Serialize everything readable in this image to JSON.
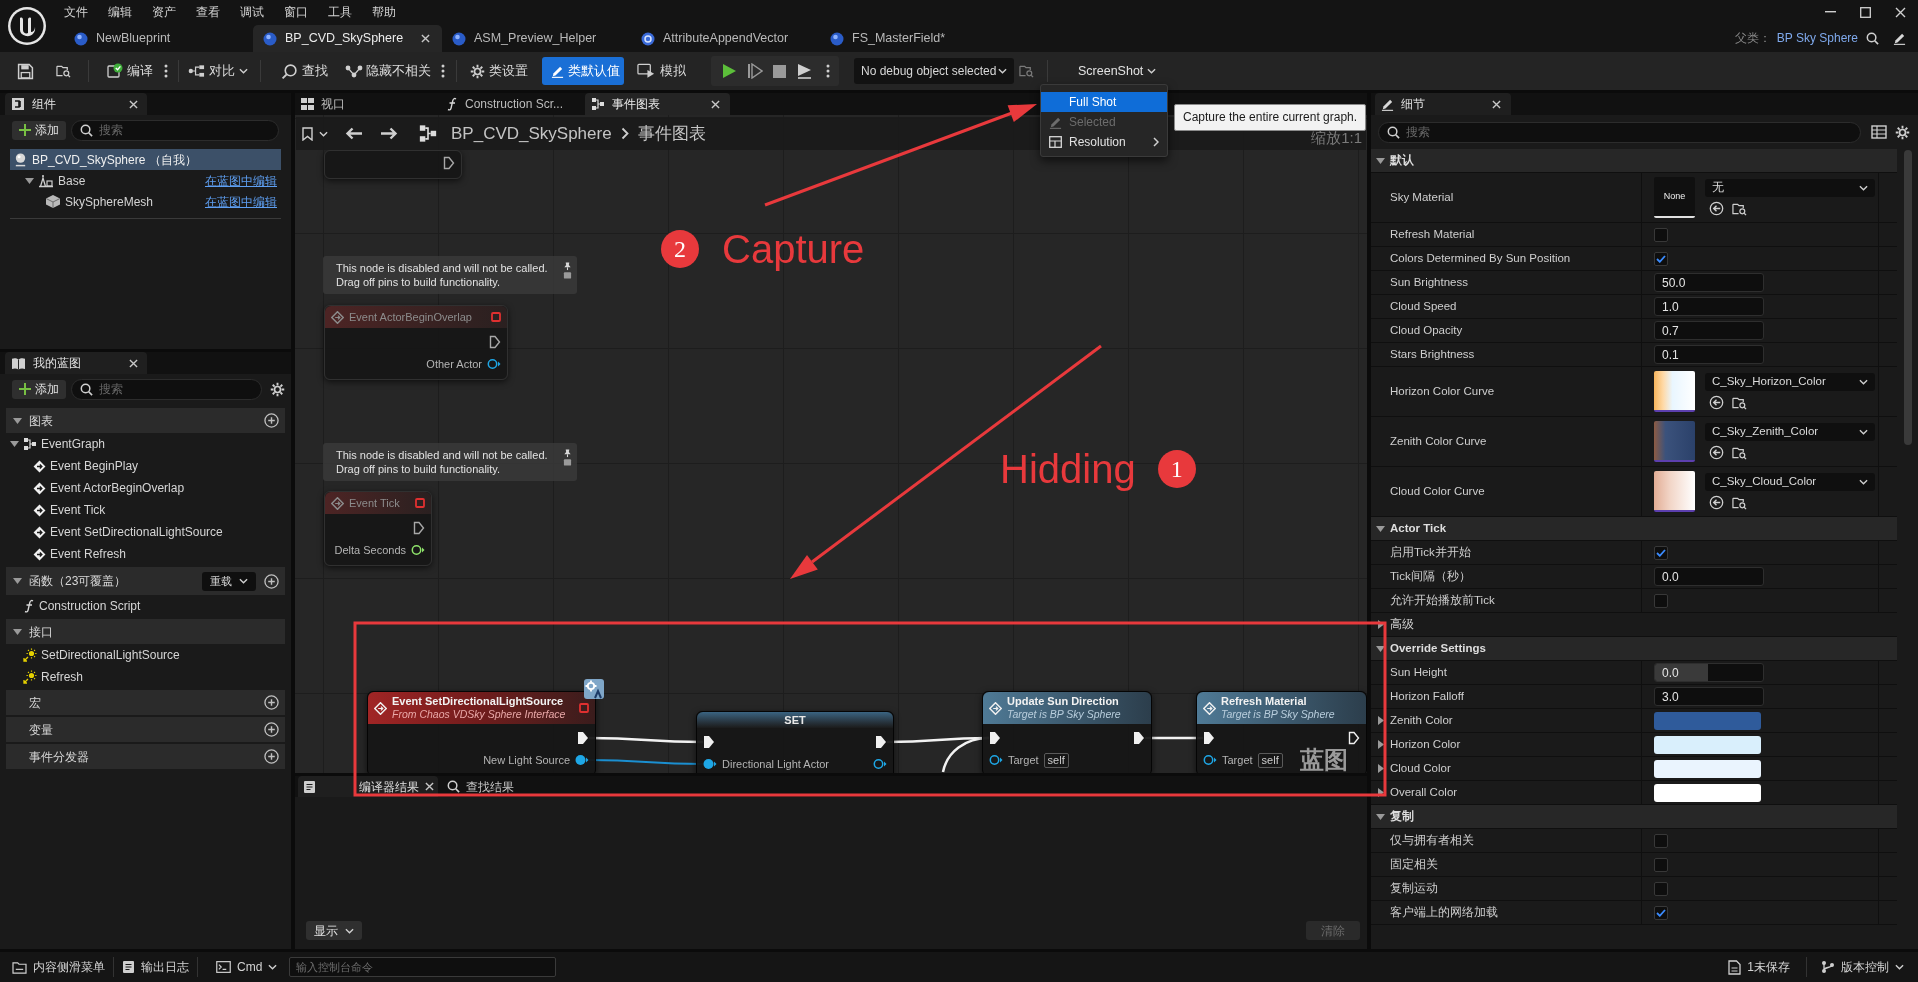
{
  "title_bar": {
    "menu": [
      "文件",
      "编辑",
      "资产",
      "查看",
      "调试",
      "窗口",
      "工具",
      "帮助"
    ]
  },
  "document_tabs": [
    {
      "label": "NewBlueprint",
      "kind": "blueprint",
      "selected": false
    },
    {
      "label": "BP_CVD_SkySphere",
      "kind": "blueprint",
      "selected": true
    },
    {
      "label": "ASM_Preview_Helper",
      "kind": "blueprint",
      "selected": false
    },
    {
      "label": "AttributeAppendVector",
      "kind": "material_function",
      "selected": false
    },
    {
      "label": "FS_MasterField*",
      "kind": "blueprint",
      "selected": false
    }
  ],
  "parent_class": {
    "label": "父类：",
    "value": "BP Sky Sphere"
  },
  "toolbar": {
    "compile": "编译",
    "diff": "对比",
    "find": "查找",
    "hide_unrelated": "隐藏不相关",
    "class_settings": "类设置",
    "class_defaults": {
      "label": "类默认值",
      "selected": true
    },
    "simulate": "模拟",
    "debug_object": "No debug object selected",
    "screenshot": "ScreenShot"
  },
  "screenshot_menu": {
    "items": [
      {
        "label": "Full Shot",
        "kind": "action",
        "selected": true,
        "disabled": false
      },
      {
        "label": "Selected",
        "kind": "selection",
        "selected": false,
        "disabled": true
      },
      {
        "label": "Resolution",
        "kind": "submenu",
        "selected": false,
        "disabled": false
      }
    ]
  },
  "tooltip": {
    "text": "Capture the entire current graph."
  },
  "components_panel": {
    "title": "组件",
    "add_button": "添加",
    "search": {
      "placeholder": "搜索"
    },
    "tree": [
      {
        "label": "BP_CVD_SkySphere （自我）",
        "kind": "actor",
        "selected": true,
        "children": [
          {
            "label": "Base",
            "kind": "scene",
            "selected": false,
            "expanded": true,
            "link": "在蓝图中编辑",
            "children": [
              {
                "label": "SkySphereMesh",
                "kind": "mesh",
                "selected": false,
                "link": "在蓝图中编辑"
              }
            ]
          }
        ]
      }
    ]
  },
  "my_blueprint_panel": {
    "title": "我的蓝图",
    "add_button": "添加",
    "search": {
      "placeholder": "搜索"
    },
    "sections": [
      {
        "title": "图表",
        "expanded": true,
        "add_button": true,
        "items": [
          {
            "label": "EventGraph",
            "kind": "graph",
            "expanded": true,
            "children": [
              {
                "label": "Event BeginPlay",
                "kind": "event"
              },
              {
                "label": "Event ActorBeginOverlap",
                "kind": "event"
              },
              {
                "label": "Event Tick",
                "kind": "event"
              },
              {
                "label": "Event SetDirectionalLightSource",
                "kind": "event"
              },
              {
                "label": "Event Refresh",
                "kind": "event"
              }
            ]
          }
        ]
      },
      {
        "title": "函数（23可覆盖）",
        "expanded": true,
        "add_button": true,
        "override_dropdown": "重载",
        "items": [
          {
            "label": "Construction Script",
            "kind": "function"
          }
        ]
      },
      {
        "title": "接口",
        "expanded": true,
        "add_button": false,
        "items": [
          {
            "label": "SetDirectionalLightSource",
            "kind": "interface"
          },
          {
            "label": "Refresh",
            "kind": "interface"
          }
        ]
      },
      {
        "title": "宏",
        "add_button": true
      },
      {
        "title": "变量",
        "add_button": true
      },
      {
        "title": "事件分发器",
        "add_button": true
      }
    ]
  },
  "graph_tabs": [
    {
      "label": "视口",
      "kind": "viewport",
      "selected": false
    },
    {
      "label": "Construction Scr...",
      "kind": "function",
      "selected": false
    },
    {
      "label": "事件图表",
      "kind": "graph",
      "selected": true
    }
  ],
  "graph": {
    "breadcrumb": [
      "BP_CVD_SkySphere",
      "事件图表"
    ],
    "zoom": "缩放1:1",
    "corner_label": "蓝图",
    "nodes": [
      {
        "kind": "event",
        "disabled": true,
        "outputs": [
          {
            "kind": "exec",
            "connected": false
          }
        ]
      },
      {
        "kind": "comment",
        "text": "This node is disabled and will not be called.\nDrag off pins to build functionality."
      },
      {
        "kind": "event",
        "title": "Event ActorBeginOverlap",
        "disabled": true,
        "outputs": [
          {
            "kind": "exec",
            "connected": false
          },
          {
            "kind": "object",
            "label": "Other Actor",
            "connected": false
          }
        ]
      },
      {
        "kind": "comment",
        "text": "This node is disabled and will not be called.\nDrag off pins to build functionality."
      },
      {
        "kind": "event",
        "title": "Event Tick",
        "disabled": true,
        "outputs": [
          {
            "kind": "exec",
            "connected": false
          },
          {
            "kind": "float",
            "label": "Delta Seconds",
            "connected": false
          }
        ]
      },
      {
        "kind": "event",
        "title": "Event SetDirectionalLightSource",
        "subtitle": "From Chaos VDSky Sphere Interface",
        "disabled": false,
        "outputs": [
          {
            "kind": "exec",
            "connected": true
          },
          {
            "kind": "object",
            "label": "New Light Source",
            "connected": true
          }
        ]
      },
      {
        "kind": "setter",
        "title": "SET",
        "inputs": [
          {
            "kind": "exec",
            "connected": true
          },
          {
            "kind": "object",
            "label": "Directional Light Actor",
            "connected": true
          }
        ],
        "outputs": [
          {
            "kind": "exec",
            "connected": true
          },
          {
            "kind": "object",
            "connected": false
          }
        ]
      },
      {
        "kind": "function",
        "title": "Update Sun Direction",
        "subtitle": "Target is BP Sky Sphere",
        "inputs": [
          {
            "kind": "exec",
            "connected": true
          },
          {
            "kind": "object",
            "label": "Target",
            "default": "self",
            "connected": false
          }
        ],
        "outputs": [
          {
            "kind": "exec",
            "connected": true
          }
        ]
      },
      {
        "kind": "function",
        "title": "Refresh Material",
        "subtitle": "Target is BP Sky Sphere",
        "inputs": [
          {
            "kind": "exec",
            "connected": true
          },
          {
            "kind": "object",
            "label": "Target",
            "default": "self",
            "connected": false
          }
        ],
        "outputs": [
          {
            "kind": "exec",
            "connected": false
          }
        ]
      }
    ]
  },
  "annotations": [
    {
      "number": "2",
      "label": "Capture"
    },
    {
      "number": "1",
      "label": "Hidding"
    }
  ],
  "results_panel": {
    "tabs": [
      {
        "label": "编译器结果",
        "kind": "log",
        "selected": true
      },
      {
        "label": "查找结果",
        "kind": "search",
        "selected": false
      }
    ],
    "show_button": "显示",
    "clear_button": {
      "label": "清除",
      "disabled": true
    }
  },
  "details_panel": {
    "title": "细节",
    "search": {
      "placeholder": "搜索"
    },
    "sections": [
      {
        "title": "默认",
        "expanded": true,
        "properties": [
          {
            "kind": "asset",
            "label": "Sky Material",
            "thumbnail": "None",
            "value": "无"
          },
          {
            "kind": "checkbox",
            "label": "Refresh Material",
            "checked": false
          },
          {
            "kind": "checkbox",
            "label": "Colors Determined By Sun Position",
            "checked": true
          },
          {
            "kind": "number",
            "label": "Sun Brightness",
            "value": "50.0"
          },
          {
            "kind": "number",
            "label": "Cloud Speed",
            "value": "1.0"
          },
          {
            "kind": "number",
            "label": "Cloud Opacity",
            "value": "0.7"
          },
          {
            "kind": "number",
            "label": "Stars Brightness",
            "value": "0.1"
          },
          {
            "kind": "curve",
            "label": "Horizon Color Curve",
            "value": "C_Sky_Horizon_Color"
          },
          {
            "kind": "curve",
            "label": "Zenith Color Curve",
            "value": "C_Sky_Zenith_Color"
          },
          {
            "kind": "curve",
            "label": "Cloud Color Curve",
            "value": "C_Sky_Cloud_Color"
          }
        ]
      },
      {
        "title": "Actor Tick",
        "expanded": true,
        "properties": [
          {
            "kind": "checkbox",
            "label": "启用Tick并开始",
            "checked": true
          },
          {
            "kind": "number",
            "label": "Tick间隔（秒）",
            "value": "0.0"
          },
          {
            "kind": "checkbox",
            "label": "允许开始播放前Tick",
            "checked": false
          },
          {
            "kind": "group",
            "label": "高级",
            "expanded": false
          }
        ]
      },
      {
        "title": "Override Settings",
        "expanded": true,
        "properties": [
          {
            "kind": "slider",
            "label": "Sun Height",
            "value": "0.0",
            "level": 0.49
          },
          {
            "kind": "number",
            "label": "Horizon Falloff",
            "value": "3.0"
          },
          {
            "kind": "color",
            "label": "Zenith Color",
            "color": "#2f5b9b",
            "expanded": false
          },
          {
            "kind": "color",
            "label": "Horizon Color",
            "color": "#d9effc",
            "expanded": false
          },
          {
            "kind": "color",
            "label": "Cloud Color",
            "color": "#eaf4fe",
            "expanded": false
          },
          {
            "kind": "color",
            "label": "Overall Color",
            "color": "#ffffff",
            "expanded": false
          }
        ]
      },
      {
        "title": "复制",
        "expanded": true,
        "properties": [
          {
            "kind": "checkbox",
            "label": "仅与拥有者相关",
            "checked": false
          },
          {
            "kind": "checkbox",
            "label": "固定相关",
            "checked": false
          },
          {
            "kind": "checkbox",
            "label": "复制运动",
            "checked": false
          },
          {
            "kind": "checkbox",
            "label": "客户端上的网络加载",
            "checked": true
          }
        ]
      }
    ]
  },
  "status_bar": {
    "content_drawer": "内容侧滑菜单",
    "output_log": "输出日志",
    "cmd": "Cmd",
    "console": {
      "placeholder": "输入控制台命令"
    },
    "unsaved": "1未保存",
    "source_control": "版本控制"
  }
}
